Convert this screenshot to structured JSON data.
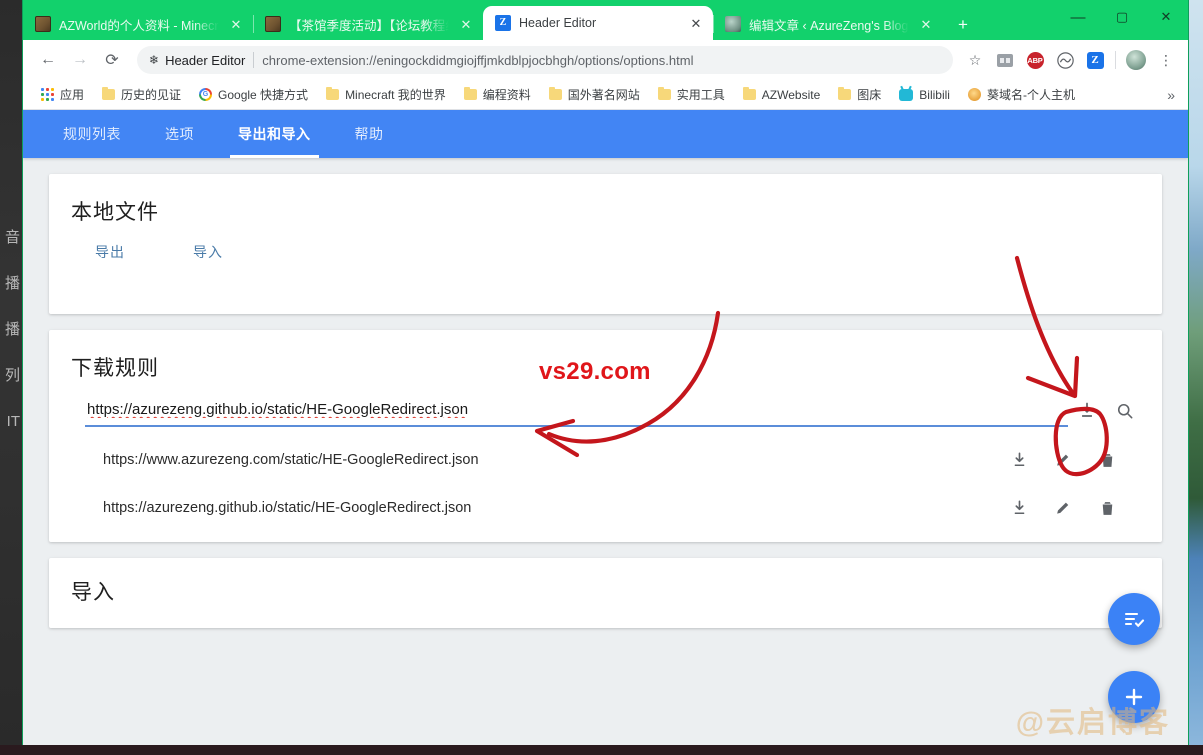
{
  "window": {
    "controls": {
      "minimize": "—",
      "maximize": "▢",
      "close": "✕"
    }
  },
  "tabs": [
    {
      "title": "AZWorld的个人资料 - Minecraft",
      "favicon": "minecraft-icon",
      "active": false,
      "close": "✕"
    },
    {
      "title": "【茶馆季度活动】【论坛教程组",
      "favicon": "minecraft-icon",
      "active": false,
      "close": "✕"
    },
    {
      "title": "Header Editor",
      "favicon": "header-editor-icon",
      "active": true,
      "close": "✕"
    },
    {
      "title": "编辑文章 ‹ AzureZeng's Blog —",
      "favicon": "blog-avatar-icon",
      "active": false,
      "close": "✕"
    }
  ],
  "newtab_label": "+",
  "toolbar": {
    "back": "←",
    "forward": "→",
    "reload": "⟳",
    "extension_name": "Header Editor",
    "url": "chrome-extension://eningockdidmgiojffjmkdblpjocbhgh/options/options.html",
    "star": "☆",
    "abp_label": "ABP",
    "menu": "⋮"
  },
  "bookmarks": {
    "items": [
      {
        "label": "应用",
        "icon": "apps-grid-icon"
      },
      {
        "label": "历史的见证",
        "icon": "folder-icon"
      },
      {
        "label": "Google 快捷方式",
        "icon": "google-icon"
      },
      {
        "label": "Minecraft 我的世界",
        "icon": "folder-icon"
      },
      {
        "label": "编程资料",
        "icon": "folder-icon"
      },
      {
        "label": "国外著名网站",
        "icon": "folder-icon"
      },
      {
        "label": "实用工具",
        "icon": "folder-icon"
      },
      {
        "label": "AZWebsite",
        "icon": "folder-icon"
      },
      {
        "label": "图床",
        "icon": "folder-icon"
      },
      {
        "label": "Bilibili",
        "icon": "bilibili-icon"
      },
      {
        "label": "葵域名-个人主机",
        "icon": "kui-icon"
      }
    ],
    "overflow": "»"
  },
  "appbar": {
    "accent": "#4285f4",
    "tabs": [
      {
        "label": "规则列表",
        "active": false
      },
      {
        "label": "选项",
        "active": false
      },
      {
        "label": "导出和导入",
        "active": true
      },
      {
        "label": "帮助",
        "active": false
      }
    ]
  },
  "cards": {
    "local_file": {
      "title": "本地文件",
      "export_label": "导出",
      "import_label": "导入"
    },
    "download_rules": {
      "title": "下载规则",
      "input_value": "https://azurezeng.github.io/static/HE-GoogleRedirect.json",
      "input_placeholder": "",
      "download_icon": "download-icon",
      "search_icon": "search-icon",
      "rows": [
        {
          "url": "https://www.azurezeng.com/static/HE-GoogleRedirect.json",
          "actions": [
            "download-icon",
            "edit-icon",
            "delete-icon"
          ]
        },
        {
          "url": "https://azurezeng.github.io/static/HE-GoogleRedirect.json",
          "actions": [
            "download-icon",
            "edit-icon",
            "delete-icon"
          ]
        }
      ]
    },
    "import": {
      "title": "导入"
    }
  },
  "fabs": [
    {
      "name": "rules-fab",
      "icon": "playlist-check-icon",
      "color": "#3b82f6"
    },
    {
      "name": "add-fab",
      "icon": "plus-icon",
      "color": "#3b82f6"
    }
  ],
  "watermark": "@云启博客",
  "annotations": {
    "text": "vs29.com",
    "color": "#c4161c",
    "arrow_to_input": "curved-arrow-left",
    "arrow_to_download": "curved-arrow-down",
    "circle_target": "download-icon"
  },
  "desktop": {
    "left_strip_text": "音\n播\n播\n列\nIT"
  }
}
